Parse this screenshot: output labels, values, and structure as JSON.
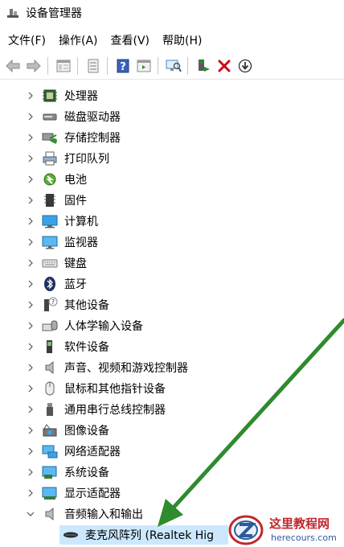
{
  "window": {
    "title": "设备管理器"
  },
  "menu": [
    {
      "label": "文件(F)"
    },
    {
      "label": "操作(A)"
    },
    {
      "label": "查看(V)"
    },
    {
      "label": "帮助(H)"
    }
  ],
  "toolbar": {
    "buttons": [
      "back-icon",
      "forward-icon",
      "properties-icon",
      "update-icon",
      "help-icon",
      "view-icon",
      "scan-icon",
      "enable-icon",
      "uninstall-icon",
      "download-icon"
    ]
  },
  "tree": {
    "items": [
      {
        "label": "处理器",
        "icon": "cpu-icon"
      },
      {
        "label": "磁盘驱动器",
        "icon": "disk-icon"
      },
      {
        "label": "存储控制器",
        "icon": "storage-icon"
      },
      {
        "label": "打印队列",
        "icon": "printer-icon"
      },
      {
        "label": "电池",
        "icon": "battery-icon"
      },
      {
        "label": "固件",
        "icon": "firmware-icon"
      },
      {
        "label": "计算机",
        "icon": "computer-icon"
      },
      {
        "label": "监视器",
        "icon": "monitor-icon"
      },
      {
        "label": "键盘",
        "icon": "keyboard-icon"
      },
      {
        "label": "蓝牙",
        "icon": "bluetooth-icon"
      },
      {
        "label": "其他设备",
        "icon": "unknown-device-icon"
      },
      {
        "label": "人体学输入设备",
        "icon": "hid-icon"
      },
      {
        "label": "软件设备",
        "icon": "software-device-icon"
      },
      {
        "label": "声音、视频和游戏控制器",
        "icon": "speaker-icon"
      },
      {
        "label": "鼠标和其他指针设备",
        "icon": "mouse-icon"
      },
      {
        "label": "通用串行总线控制器",
        "icon": "usb-icon"
      },
      {
        "label": "图像设备",
        "icon": "camera-icon"
      },
      {
        "label": "网络适配器",
        "icon": "network-icon"
      },
      {
        "label": "系统设备",
        "icon": "system-icon"
      },
      {
        "label": "显示适配器",
        "icon": "display-adapter-icon"
      },
      {
        "label": "音频输入和输出",
        "icon": "speaker-icon",
        "expanded": true
      }
    ],
    "child": {
      "label": "麦克风阵列 (Realtek Hig",
      "icon": "microphone-array-icon"
    }
  },
  "watermark": {
    "name": "这里教程网",
    "url": "herecours.com"
  },
  "colors": {
    "selection": "#cce8ff",
    "arrow": "#2e8b2e",
    "uninstall": "#d0021b"
  }
}
